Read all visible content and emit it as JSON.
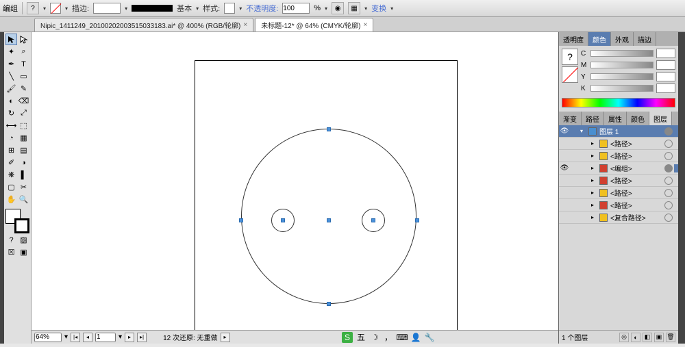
{
  "toolbar": {
    "group_label": "编组",
    "stroke_label": "描边:",
    "basic_label": "基本",
    "style_label": "样式:",
    "opacity_label": "不透明度:",
    "opacity_value": "100",
    "transform_link": "变换"
  },
  "tabs": [
    {
      "label": "Nipic_1411249_20100202003515033183.ai* @ 400%  (RGB/轮廓)",
      "active": false
    },
    {
      "label": "未标题-12* @ 64%  (CMYK/轮廓)",
      "active": true
    }
  ],
  "panels": {
    "color": {
      "tabs": [
        "透明度",
        "颜色",
        "外观",
        "描边"
      ],
      "active_tab": "颜色",
      "channels": [
        {
          "letter": "C",
          "value": ""
        },
        {
          "letter": "M",
          "value": ""
        },
        {
          "letter": "Y",
          "value": ""
        },
        {
          "letter": "K",
          "value": ""
        }
      ]
    },
    "layers": {
      "tabs": [
        "渐变",
        "路径",
        "属性",
        "颜色",
        "图层"
      ],
      "active_tab": "图层",
      "items": [
        {
          "type": "header",
          "name": "图层 1",
          "swatch": "#4a8fd0",
          "visible": true,
          "target": true
        },
        {
          "type": "item",
          "name": "<路径>",
          "swatch": "#f0c020",
          "visible": false,
          "target": false
        },
        {
          "type": "item",
          "name": "<路径>",
          "swatch": "#f0c020",
          "visible": false,
          "target": false
        },
        {
          "type": "item",
          "name": "<编组>",
          "swatch": "#d04030",
          "visible": true,
          "target": true,
          "selected": true
        },
        {
          "type": "item",
          "name": "<路径>",
          "swatch": "#d04030",
          "visible": false,
          "target": false
        },
        {
          "type": "item",
          "name": "<路径>",
          "swatch": "#f0c020",
          "visible": false,
          "target": false
        },
        {
          "type": "item",
          "name": "<路径>",
          "swatch": "#d04030",
          "visible": false,
          "target": false
        },
        {
          "type": "item",
          "name": "<复合路径>",
          "swatch": "#f0c020",
          "visible": false,
          "target": false
        }
      ],
      "footer_text": "1 个图层"
    }
  },
  "bottom": {
    "zoom": "64%",
    "page": "1",
    "undo_text": "12 次还原: 无重做",
    "ime_label": "五"
  }
}
